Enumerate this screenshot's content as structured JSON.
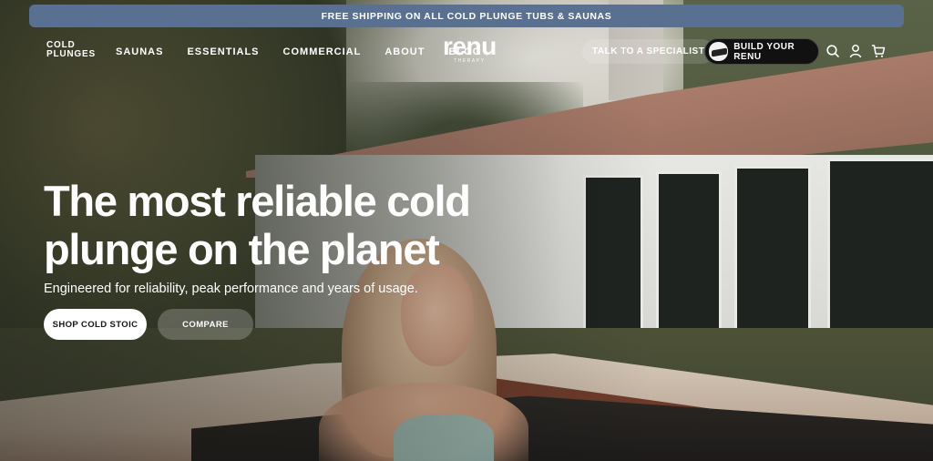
{
  "announcement": {
    "text": "FREE SHIPPING ON ALL COLD PLUNGE TUBS & SAUNAS"
  },
  "header": {
    "logo_line1": "COLD",
    "logo_line2": "PLUNGES",
    "nav": [
      "SAUNAS",
      "ESSENTIALS",
      "COMMERCIAL",
      "ABOUT",
      "BLOG"
    ],
    "brand_word": "renu",
    "brand_sub": "THERAPY",
    "specialist_label": "TALK TO A SPECIALIST",
    "build_label": "BUILD YOUR RENU",
    "icons": [
      "search-icon",
      "account-icon",
      "cart-icon"
    ]
  },
  "hero": {
    "headline_line1": "The most reliable cold",
    "headline_line2": "plunge on the planet",
    "subline": "Engineered for reliability, peak performance and years of usage.",
    "shop_label": "SHOP COLD STOIC",
    "compare_label": "COMPARE"
  },
  "colors": {
    "announcement_bg": "#5a7091",
    "build_button_bg": "#111111",
    "primary_button_bg": "#ffffff"
  }
}
